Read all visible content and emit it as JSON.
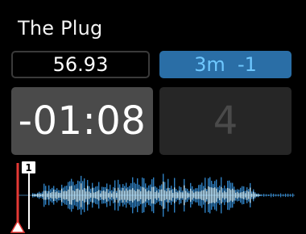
{
  "deck": {
    "track_title": "The Plug",
    "bpm": "56.93",
    "key": "3m  -1",
    "time_remaining": "-01:08",
    "beat_counter": "4",
    "cue_marker_label": "1",
    "playhead_position": 0,
    "colors": {
      "background": "#000000",
      "key_box": "#2a6ea6",
      "key_text": "#6fc8ff",
      "time_box": "#4a4a4a",
      "beat_box": "#262626",
      "playhead": "#e53935",
      "waveform_outer": "#2f7fc0",
      "waveform_inner": "#bfe8ff"
    }
  }
}
